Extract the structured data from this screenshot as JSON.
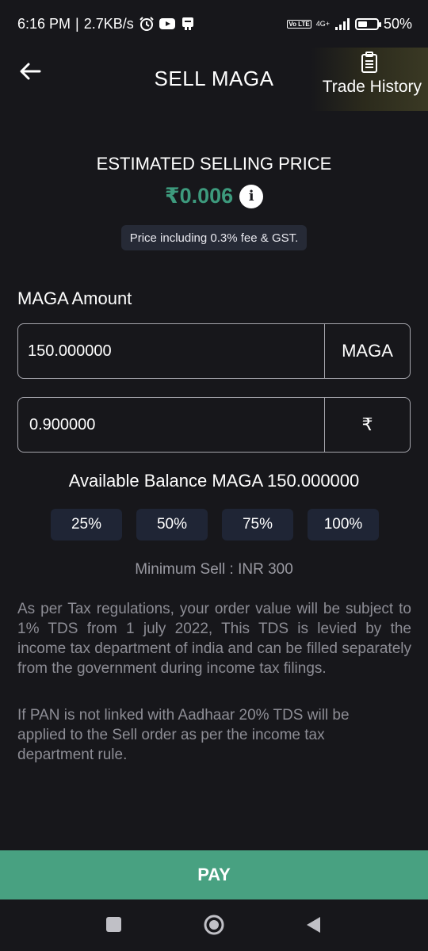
{
  "status_bar": {
    "time": "6:16 PM",
    "separator": "|",
    "speed": "2.7KB/s",
    "network": "4G+",
    "lte": "Vo LTE",
    "battery": "50%",
    "battery_level": 0.5,
    "icons": [
      "alarm-icon",
      "youtube-icon",
      "notification-icon",
      "signal-icon",
      "battery-icon"
    ]
  },
  "header": {
    "title": "SELL MAGA",
    "back_icon": "back-arrow-icon",
    "trade_history_label": "Trade History",
    "trade_history_icon": "clipboard-icon"
  },
  "price": {
    "title": "ESTIMATED SELLING PRICE",
    "value": "₹0.006",
    "info_icon": "i",
    "fee_note": "Price including 0.3% fee & GST.",
    "accent_color": "#3d9a7d"
  },
  "amount": {
    "label": "MAGA Amount",
    "crypto_value": "150.000000",
    "crypto_unit": "MAGA",
    "inr_value": "0.900000",
    "inr_unit": "₹"
  },
  "balance": {
    "text": "Available Balance MAGA 150.000000"
  },
  "percent_buttons": [
    "25%",
    "50%",
    "75%",
    "100%"
  ],
  "min_sell": "Minimum Sell :  INR 300",
  "notes": {
    "tax": "As per Tax regulations, your order value will be subject to 1% TDS from 1 july 2022, This TDS is levied by the income tax department of india and can be filled separately from the government during income tax filings.",
    "pan": "If PAN is not linked with Aadhaar 20% TDS will be applied to the Sell order as per the income tax department rule."
  },
  "pay_button": {
    "label": "PAY",
    "color": "#48a181"
  },
  "nav_bar": {
    "icons": [
      "recents-icon",
      "home-icon",
      "back-icon"
    ]
  }
}
